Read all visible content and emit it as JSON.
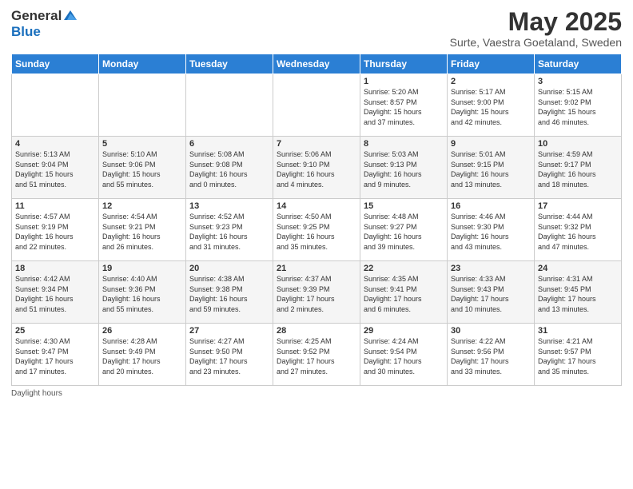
{
  "header": {
    "logo_general": "General",
    "logo_blue": "Blue",
    "main_title": "May 2025",
    "subtitle": "Surte, Vaestra Goetaland, Sweden"
  },
  "days_of_week": [
    "Sunday",
    "Monday",
    "Tuesday",
    "Wednesday",
    "Thursday",
    "Friday",
    "Saturday"
  ],
  "weeks": [
    [
      {
        "day": "",
        "info": ""
      },
      {
        "day": "",
        "info": ""
      },
      {
        "day": "",
        "info": ""
      },
      {
        "day": "",
        "info": ""
      },
      {
        "day": "1",
        "info": "Sunrise: 5:20 AM\nSunset: 8:57 PM\nDaylight: 15 hours\nand 37 minutes."
      },
      {
        "day": "2",
        "info": "Sunrise: 5:17 AM\nSunset: 9:00 PM\nDaylight: 15 hours\nand 42 minutes."
      },
      {
        "day": "3",
        "info": "Sunrise: 5:15 AM\nSunset: 9:02 PM\nDaylight: 15 hours\nand 46 minutes."
      }
    ],
    [
      {
        "day": "4",
        "info": "Sunrise: 5:13 AM\nSunset: 9:04 PM\nDaylight: 15 hours\nand 51 minutes."
      },
      {
        "day": "5",
        "info": "Sunrise: 5:10 AM\nSunset: 9:06 PM\nDaylight: 15 hours\nand 55 minutes."
      },
      {
        "day": "6",
        "info": "Sunrise: 5:08 AM\nSunset: 9:08 PM\nDaylight: 16 hours\nand 0 minutes."
      },
      {
        "day": "7",
        "info": "Sunrise: 5:06 AM\nSunset: 9:10 PM\nDaylight: 16 hours\nand 4 minutes."
      },
      {
        "day": "8",
        "info": "Sunrise: 5:03 AM\nSunset: 9:13 PM\nDaylight: 16 hours\nand 9 minutes."
      },
      {
        "day": "9",
        "info": "Sunrise: 5:01 AM\nSunset: 9:15 PM\nDaylight: 16 hours\nand 13 minutes."
      },
      {
        "day": "10",
        "info": "Sunrise: 4:59 AM\nSunset: 9:17 PM\nDaylight: 16 hours\nand 18 minutes."
      }
    ],
    [
      {
        "day": "11",
        "info": "Sunrise: 4:57 AM\nSunset: 9:19 PM\nDaylight: 16 hours\nand 22 minutes."
      },
      {
        "day": "12",
        "info": "Sunrise: 4:54 AM\nSunset: 9:21 PM\nDaylight: 16 hours\nand 26 minutes."
      },
      {
        "day": "13",
        "info": "Sunrise: 4:52 AM\nSunset: 9:23 PM\nDaylight: 16 hours\nand 31 minutes."
      },
      {
        "day": "14",
        "info": "Sunrise: 4:50 AM\nSunset: 9:25 PM\nDaylight: 16 hours\nand 35 minutes."
      },
      {
        "day": "15",
        "info": "Sunrise: 4:48 AM\nSunset: 9:27 PM\nDaylight: 16 hours\nand 39 minutes."
      },
      {
        "day": "16",
        "info": "Sunrise: 4:46 AM\nSunset: 9:30 PM\nDaylight: 16 hours\nand 43 minutes."
      },
      {
        "day": "17",
        "info": "Sunrise: 4:44 AM\nSunset: 9:32 PM\nDaylight: 16 hours\nand 47 minutes."
      }
    ],
    [
      {
        "day": "18",
        "info": "Sunrise: 4:42 AM\nSunset: 9:34 PM\nDaylight: 16 hours\nand 51 minutes."
      },
      {
        "day": "19",
        "info": "Sunrise: 4:40 AM\nSunset: 9:36 PM\nDaylight: 16 hours\nand 55 minutes."
      },
      {
        "day": "20",
        "info": "Sunrise: 4:38 AM\nSunset: 9:38 PM\nDaylight: 16 hours\nand 59 minutes."
      },
      {
        "day": "21",
        "info": "Sunrise: 4:37 AM\nSunset: 9:39 PM\nDaylight: 17 hours\nand 2 minutes."
      },
      {
        "day": "22",
        "info": "Sunrise: 4:35 AM\nSunset: 9:41 PM\nDaylight: 17 hours\nand 6 minutes."
      },
      {
        "day": "23",
        "info": "Sunrise: 4:33 AM\nSunset: 9:43 PM\nDaylight: 17 hours\nand 10 minutes."
      },
      {
        "day": "24",
        "info": "Sunrise: 4:31 AM\nSunset: 9:45 PM\nDaylight: 17 hours\nand 13 minutes."
      }
    ],
    [
      {
        "day": "25",
        "info": "Sunrise: 4:30 AM\nSunset: 9:47 PM\nDaylight: 17 hours\nand 17 minutes."
      },
      {
        "day": "26",
        "info": "Sunrise: 4:28 AM\nSunset: 9:49 PM\nDaylight: 17 hours\nand 20 minutes."
      },
      {
        "day": "27",
        "info": "Sunrise: 4:27 AM\nSunset: 9:50 PM\nDaylight: 17 hours\nand 23 minutes."
      },
      {
        "day": "28",
        "info": "Sunrise: 4:25 AM\nSunset: 9:52 PM\nDaylight: 17 hours\nand 27 minutes."
      },
      {
        "day": "29",
        "info": "Sunrise: 4:24 AM\nSunset: 9:54 PM\nDaylight: 17 hours\nand 30 minutes."
      },
      {
        "day": "30",
        "info": "Sunrise: 4:22 AM\nSunset: 9:56 PM\nDaylight: 17 hours\nand 33 minutes."
      },
      {
        "day": "31",
        "info": "Sunrise: 4:21 AM\nSunset: 9:57 PM\nDaylight: 17 hours\nand 35 minutes."
      }
    ]
  ],
  "footer": {
    "note": "Daylight hours"
  }
}
